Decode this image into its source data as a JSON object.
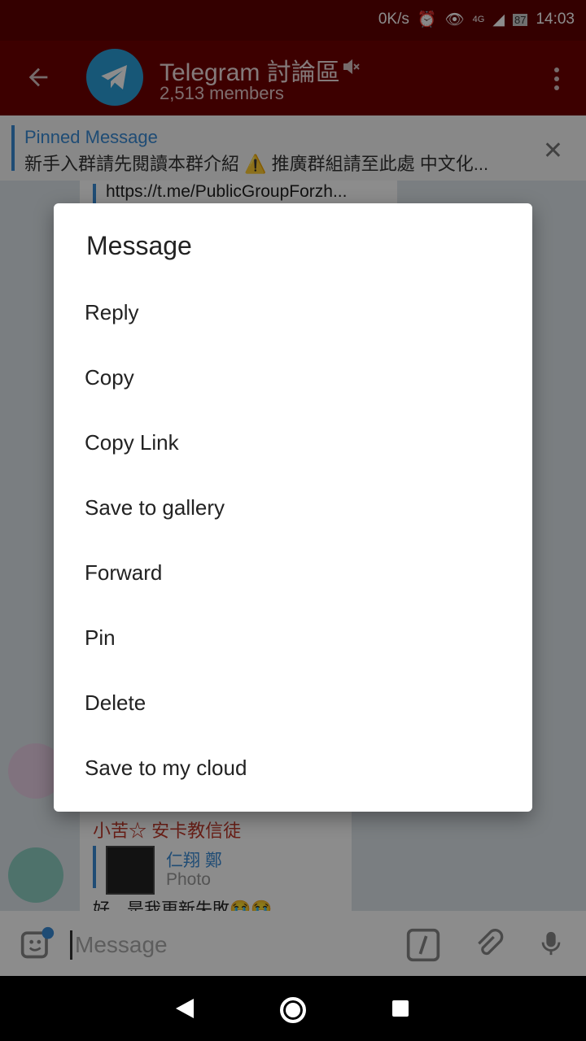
{
  "status": {
    "speed": "0K/s",
    "network": "4G",
    "battery": "87",
    "time": "14:03"
  },
  "header": {
    "title": "Telegram 討論區",
    "members": "2,513 members"
  },
  "pinned": {
    "label": "Pinned Message",
    "text": "新手入群請先閱讀本群介紹 ⚠️ 推廣群組請至此處 中文化..."
  },
  "chat": {
    "link": "https://t.me/PublicGroupForzh...",
    "sender": "小苦☆ 安卡教信徒",
    "reply_name": "仁翔 鄭",
    "reply_type": "Photo",
    "message_text": "好，是我更新失敗😭😭"
  },
  "input": {
    "placeholder": "Message"
  },
  "dialog": {
    "title": "Message",
    "items": [
      {
        "label": "Reply"
      },
      {
        "label": "Copy"
      },
      {
        "label": "Copy Link"
      },
      {
        "label": "Save to gallery"
      },
      {
        "label": "Forward"
      },
      {
        "label": "Pin"
      },
      {
        "label": "Delete"
      },
      {
        "label": "Save to my cloud"
      }
    ]
  },
  "colors": {
    "accent": "#3a8bd6",
    "appbar": "#6f0000",
    "channel_avatar": "#2b9fd9"
  }
}
